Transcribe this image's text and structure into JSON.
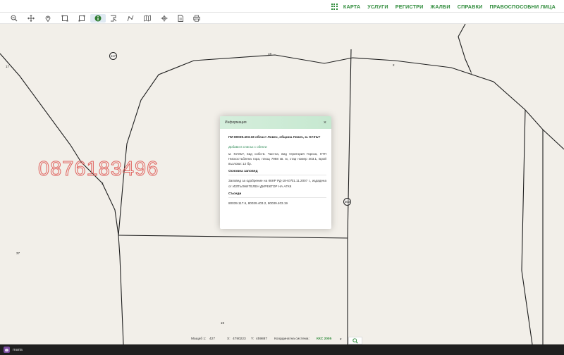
{
  "nav": {
    "items": [
      "КАРТА",
      "УСЛУГИ",
      "РЕГИСТРИ",
      "ЖАЛБИ",
      "СПРАВКИ",
      "ПРАВОСПОСОБНИ ЛИЦА"
    ]
  },
  "toolbar": {
    "icons": [
      "zoom-out-icon",
      "pan-icon",
      "location-pin-icon",
      "select-rectangle-icon",
      "edit-rectangle-icon",
      "info-icon",
      "select-polygon-icon",
      "measure-icon",
      "map-icon",
      "coordinates-icon",
      "document-icon",
      "print-icon"
    ],
    "active": "info-icon"
  },
  "map": {
    "labels": {
      "p17_left": "17",
      "p18_top": "18",
      "p2": "2",
      "p1": "1",
      "p8": "8",
      "p37": "37",
      "p19": "19"
    },
    "circles": {
      "c117": "117",
      "c403": "403"
    },
    "watermark": "0876183496"
  },
  "popup": {
    "title": "Информация",
    "close": "×",
    "property_title": "ПИ 80039.403.18 област Ловеч, община Ловеч, м. КУЗЪТ",
    "add_link": "Добави в списък с обекти",
    "description": "м. КУЗЪТ, вид собств. Частна, вид територия Горска, НТП Нискостъблена гора, площ 7968 кв. м, стар номер 403.1, Брой възлови: 12 бр.",
    "order_header": "Основна заповед",
    "order_text": "Заповед за одобрение на КККР РД-18-67/01.11.2007 г., издадена от ИЗПЪЛНИТЕЛЕН ДИРЕКТОР НА АГКК",
    "neighbors_header": "Съседи",
    "neighbors_text": "80039.117.6, 80039.403.2, 80039.403.19"
  },
  "status": {
    "scale_label": "Мащаб 1:",
    "scale_value": "427",
    "x_label": "X:",
    "x_value": "4790223",
    "y_label": "Y:",
    "y_value": "459887",
    "crs_label": "Координатна система:",
    "crs_value": "ККС 2005"
  },
  "taskbar": {
    "user": "maria"
  },
  "colors": {
    "accent": "#2e8b3a",
    "map_bg": "#f2efe9",
    "watermark": "#e0625e",
    "popup_header": "#cfeed8"
  }
}
